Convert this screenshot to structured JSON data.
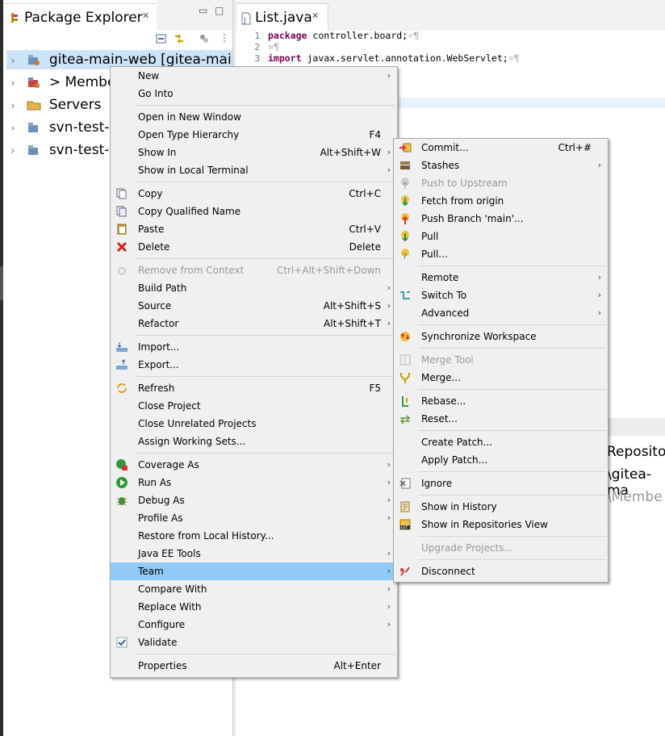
{
  "package_explorer": {
    "title": "Package Explorer",
    "tree": [
      {
        "label": "gitea-main-web [gitea-main-w",
        "selected": true
      },
      {
        "label": "> Membe"
      },
      {
        "label": "Servers"
      },
      {
        "label": "svn-test-w"
      },
      {
        "label": "svn-test-w"
      }
    ]
  },
  "editor": {
    "tab_label": "List.java",
    "lines": [
      {
        "num": "1",
        "kw": "package",
        "text": " controller.board;",
        "ws": "¤¶"
      },
      {
        "num": "2",
        "kw": "",
        "text": "",
        "ws": "¤¶"
      },
      {
        "num": "3",
        "kw": "import",
        "text": " javax.servlet.annotation.WebServlet;",
        "ws": "¤¶"
      }
    ]
  },
  "bottom_panel": {
    "line1": "Reposito",
    "line2": "\\gitea-ma",
    "line3": "\\Membe"
  },
  "context_menu": {
    "items": {
      "new": "New",
      "go_into": "Go Into",
      "open_new_window": "Open in New Window",
      "open_type_hierarchy": "Open Type Hierarchy",
      "open_type_hierarchy_acc": "F4",
      "show_in": "Show In",
      "show_in_acc": "Alt+Shift+W",
      "show_local_terminal": "Show in Local Terminal",
      "copy": "Copy",
      "copy_acc": "Ctrl+C",
      "copy_qualified": "Copy Qualified Name",
      "paste": "Paste",
      "paste_acc": "Ctrl+V",
      "delete": "Delete",
      "delete_acc": "Delete",
      "remove_context": "Remove from Context",
      "remove_context_acc": "Ctrl+Alt+Shift+Down",
      "build_path": "Build Path",
      "source": "Source",
      "source_acc": "Alt+Shift+S",
      "refactor": "Refactor",
      "refactor_acc": "Alt+Shift+T",
      "import": "Import...",
      "export": "Export...",
      "refresh": "Refresh",
      "refresh_acc": "F5",
      "close_project": "Close Project",
      "close_unrelated": "Close Unrelated Projects",
      "assign_sets": "Assign Working Sets...",
      "coverage_as": "Coverage As",
      "run_as": "Run As",
      "debug_as": "Debug As",
      "profile_as": "Profile As",
      "restore_history": "Restore from Local History...",
      "java_ee_tools": "Java EE Tools",
      "team": "Team",
      "compare_with": "Compare With",
      "replace_with": "Replace With",
      "configure": "Configure",
      "validate": "Validate",
      "properties": "Properties",
      "properties_acc": "Alt+Enter"
    }
  },
  "team_menu": {
    "items": {
      "commit": "Commit...",
      "commit_acc": "Ctrl+#",
      "stashes": "Stashes",
      "push_upstream": "Push to Upstream",
      "fetch_origin": "Fetch from origin",
      "push_branch": "Push Branch 'main'...",
      "pull": "Pull",
      "pull_dots": "Pull...",
      "remote": "Remote",
      "switch_to": "Switch To",
      "advanced": "Advanced",
      "sync_workspace": "Synchronize Workspace",
      "merge_tool": "Merge Tool",
      "merge": "Merge...",
      "rebase": "Rebase...",
      "reset": "Reset...",
      "create_patch": "Create Patch...",
      "apply_patch": "Apply Patch...",
      "ignore": "Ignore",
      "show_history": "Show in History",
      "show_repos_view": "Show in Repositories View",
      "upgrade_projects": "Upgrade Projects...",
      "disconnect": "Disconnect"
    }
  },
  "colors": {
    "highlight": "#91c9f7",
    "menu_bg": "#f0f0f0",
    "selection": "#cde3f7",
    "keyword": "#7f0055"
  }
}
